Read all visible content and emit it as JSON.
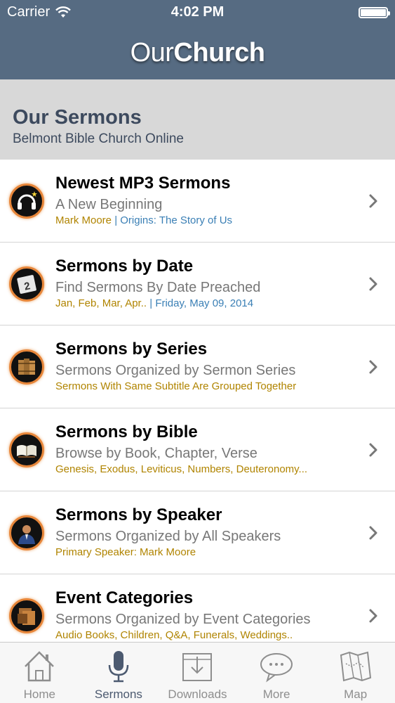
{
  "status_bar": {
    "carrier": "Carrier",
    "time": "4:02 PM"
  },
  "header": {
    "title_part1": "Our",
    "title_part2": "Church"
  },
  "section": {
    "title": "Our Sermons",
    "subtitle": "Belmont Bible Church Online"
  },
  "items": [
    {
      "title": "Newest MP3 Sermons",
      "subtitle": "A New Beginning",
      "meta_a": "Mark Moore",
      "meta_sep": " | ",
      "meta_b": "Origins: The Story of Us",
      "icon": "headphones-icon"
    },
    {
      "title": "Sermons by Date",
      "subtitle": "Find Sermons By Date Preached",
      "meta_a": "Jan, Feb, Mar, Apr..",
      "meta_sep": " | ",
      "meta_b": "Friday, May 09, 2014",
      "icon": "calendar-icon"
    },
    {
      "title": "Sermons by Series",
      "subtitle": "Sermons Organized by Sermon Series",
      "meta_a": "Sermons With Same Subtitle Are Grouped Together",
      "meta_sep": "",
      "meta_b": "",
      "icon": "books-icon"
    },
    {
      "title": "Sermons by Bible",
      "subtitle": "Browse by Book, Chapter, Verse",
      "meta_a": "Genesis, Exodus, Leviticus, Numbers, Deuteronomy...",
      "meta_sep": "",
      "meta_b": "",
      "icon": "open-bible-icon"
    },
    {
      "title": "Sermons by Speaker",
      "subtitle": "Sermons Organized by All Speakers",
      "meta_a": "Primary Speaker: Mark Moore",
      "meta_sep": "",
      "meta_b": "",
      "icon": "speaker-icon"
    },
    {
      "title": "Event Categories",
      "subtitle": "Sermons Organized by Event Categories",
      "meta_a": "Audio Books, Children, Q&A, Funerals, Weddings..",
      "meta_sep": "",
      "meta_b": "",
      "icon": "folders-icon"
    }
  ],
  "tabs": [
    {
      "label": "Home",
      "icon": "home-icon"
    },
    {
      "label": "Sermons",
      "icon": "microphone-icon"
    },
    {
      "label": "Downloads",
      "icon": "download-icon"
    },
    {
      "label": "More",
      "icon": "chat-bubble-icon"
    },
    {
      "label": "Map",
      "icon": "map-icon"
    }
  ],
  "colors": {
    "header_bg": "#566b82",
    "section_bg": "#d8d8d8",
    "meta_gold": "#b08400",
    "meta_blue": "#3a7fb5",
    "icon_ring": "#e7863a"
  }
}
